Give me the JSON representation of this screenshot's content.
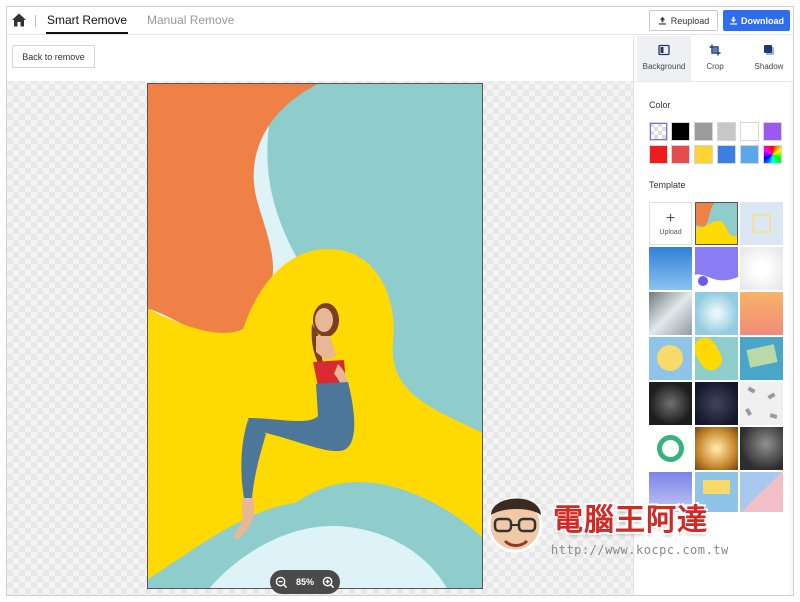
{
  "topbar": {
    "tabs": [
      {
        "label": "Smart Remove",
        "active": true
      },
      {
        "label": "Manual Remove",
        "active": false
      }
    ],
    "reupload_label": "Reupload",
    "download_label": "Download",
    "accent": "#2f6df0"
  },
  "toolbar": {
    "back_label": "Back to remove"
  },
  "zoom": {
    "level": "85%"
  },
  "panel": {
    "tabs": [
      {
        "label": "Background",
        "icon": "background-icon",
        "active": true
      },
      {
        "label": "Crop",
        "icon": "crop-icon",
        "active": false
      },
      {
        "label": "Shadow",
        "icon": "shadow-icon",
        "active": false
      }
    ],
    "color_title": "Color",
    "colors": [
      "transparent",
      "#000000",
      "#9b9b9b",
      "#c7c7c7",
      "#ffffff",
      "#9b59f0",
      "#ee1c1c",
      "#e74c4c",
      "#fcd534",
      "#3b7fe0",
      "#5aa7ea",
      "rainbow"
    ],
    "template_title": "Template",
    "upload_label": "Upload"
  },
  "watermark": {
    "title": "電腦王阿達",
    "url": "http://www.kocpc.com.tw"
  }
}
